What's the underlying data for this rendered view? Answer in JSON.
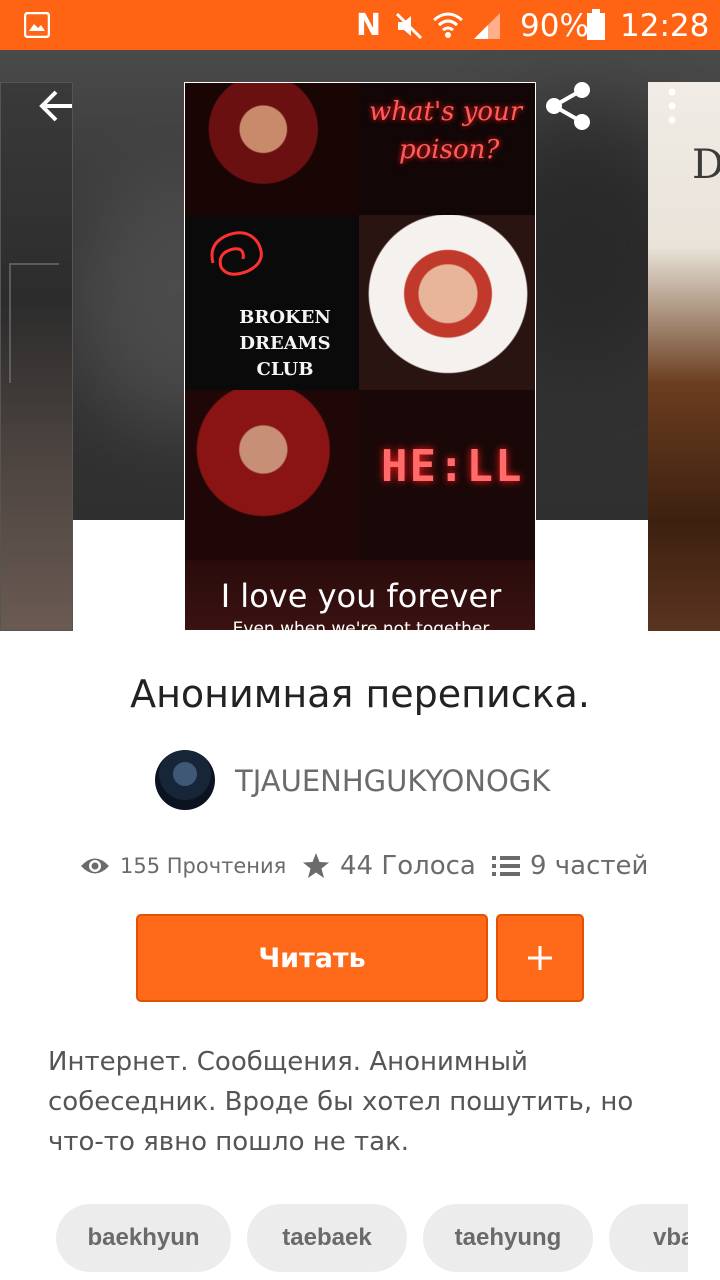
{
  "status_bar": {
    "battery": "90%",
    "time": "12:28",
    "icons": [
      "gallery-icon",
      "nfc-icon",
      "mute-icon",
      "wifi-icon",
      "signal-icon",
      "battery-icon"
    ],
    "background_color": "#ff6314"
  },
  "nav": {
    "back_icon": "arrow-left-icon",
    "share_icon": "share-icon",
    "more_icon": "more-vertical-icon"
  },
  "cover": {
    "neon_line_1": "what's your",
    "neon_line_2": "poison?",
    "club_text": "BROKEN DREAMS CLUB",
    "hell_text": "HE:LL",
    "caption": "I love you forever",
    "subcaption": "Even when we're not together",
    "side_right_letter": "D"
  },
  "story": {
    "title": "Анонимная переписка.",
    "author": "TJAUENHGUKYONOGK",
    "stats": {
      "reads": "155 Прочтения",
      "votes": "44 Голоса",
      "parts": "9 частей"
    },
    "read_label": "Читать",
    "add_label": "+",
    "description": "Интернет. Сообщения. Анонимный собеседник. Вроде бы хотел пошутить, но что-то явно пошло не так.",
    "tags": [
      "baekhyun",
      "taebaek",
      "taehyung",
      "vba"
    ]
  },
  "colors": {
    "accent": "#ff6a1a",
    "accent_border": "#e25200",
    "tag_bg": "#ececec",
    "text_muted": "#6b6b6b"
  }
}
